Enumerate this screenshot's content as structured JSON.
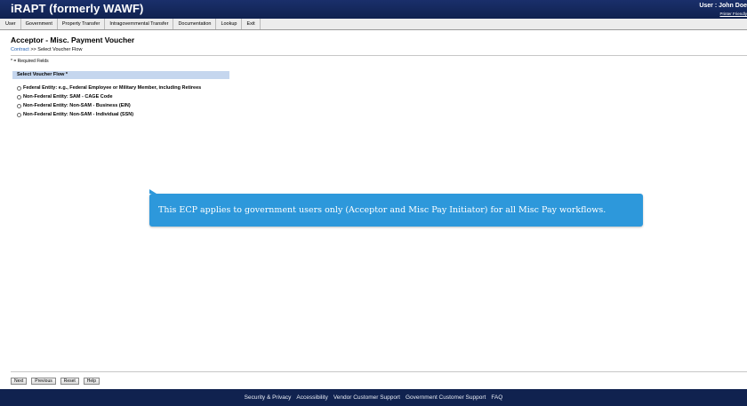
{
  "header": {
    "app_title": "iRAPT (formerly WAWF)",
    "user_label": "User : John Doe",
    "printer_link": "Printer Friendly"
  },
  "menu": {
    "items": [
      "User",
      "Government",
      "Property Transfer",
      "Intragovernmental Transfer",
      "Documentation",
      "Lookup",
      "Exit"
    ]
  },
  "page": {
    "title": "Acceptor - Misc. Payment Voucher",
    "breadcrumb_link": "Contract",
    "breadcrumb_rest": " >> Select Voucher Flow",
    "required_note": "* = Required Fields"
  },
  "voucher_flow": {
    "header": "Select Voucher Flow *",
    "options": [
      "Federal Entity: e.g., Federal Employee or Military Member, including Retirees",
      "Non-Federal Entity: SAM - CAGE Code",
      "Non-Federal Entity: Non-SAM - Business (EIN)",
      "Non-Federal Entity: Non-SAM - Individual (SSN)"
    ]
  },
  "tooltip": {
    "text": "This ECP applies to government users only (Acceptor and Misc Pay Initiator) for all Misc Pay workflows."
  },
  "buttons": {
    "next": "Next",
    "previous": "Previous",
    "reset": "Reset",
    "help": "Help"
  },
  "footer": {
    "links": [
      "Security & Privacy",
      "Accessibility",
      "Vendor Customer Support",
      "Government Customer Support",
      "FAQ"
    ]
  },
  "colors": {
    "topbar": "#1a2f6b",
    "section_header": "#c5d6ee",
    "tooltip": "#2d98db",
    "link": "#1f5fb3"
  }
}
